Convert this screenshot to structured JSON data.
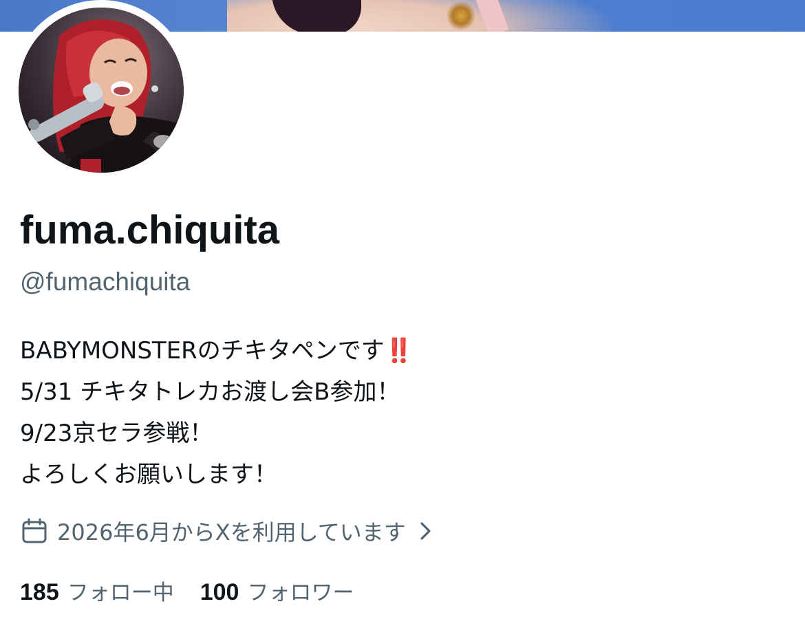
{
  "banner": {
    "icon": "header-banner-image"
  },
  "profile": {
    "avatar_icon": "avatar-photo",
    "display_name": "fuma.chiquita",
    "handle": "@fumachiquita",
    "bio": {
      "line1_text": "BABYMONSTERのチキタペンです",
      "line1_emoji": "‼️",
      "line2": "5/31 チキタトレカお渡し会B参加！",
      "line3": "9/23京セラ参戦！",
      "line4": "よろしくお願いします！"
    },
    "joined": {
      "icon": "calendar-icon",
      "text": "2026年6月からXを利用しています",
      "chevron_icon": "chevron-right-icon"
    },
    "stats": {
      "following_count": "185",
      "following_label": "フォロー中",
      "followers_count": "100",
      "followers_label": "フォロワー"
    }
  },
  "colors": {
    "text_primary": "#0f1419",
    "text_secondary": "#536471",
    "emoji_red": "#e0281f",
    "banner_blue": "#4f7fd0"
  }
}
